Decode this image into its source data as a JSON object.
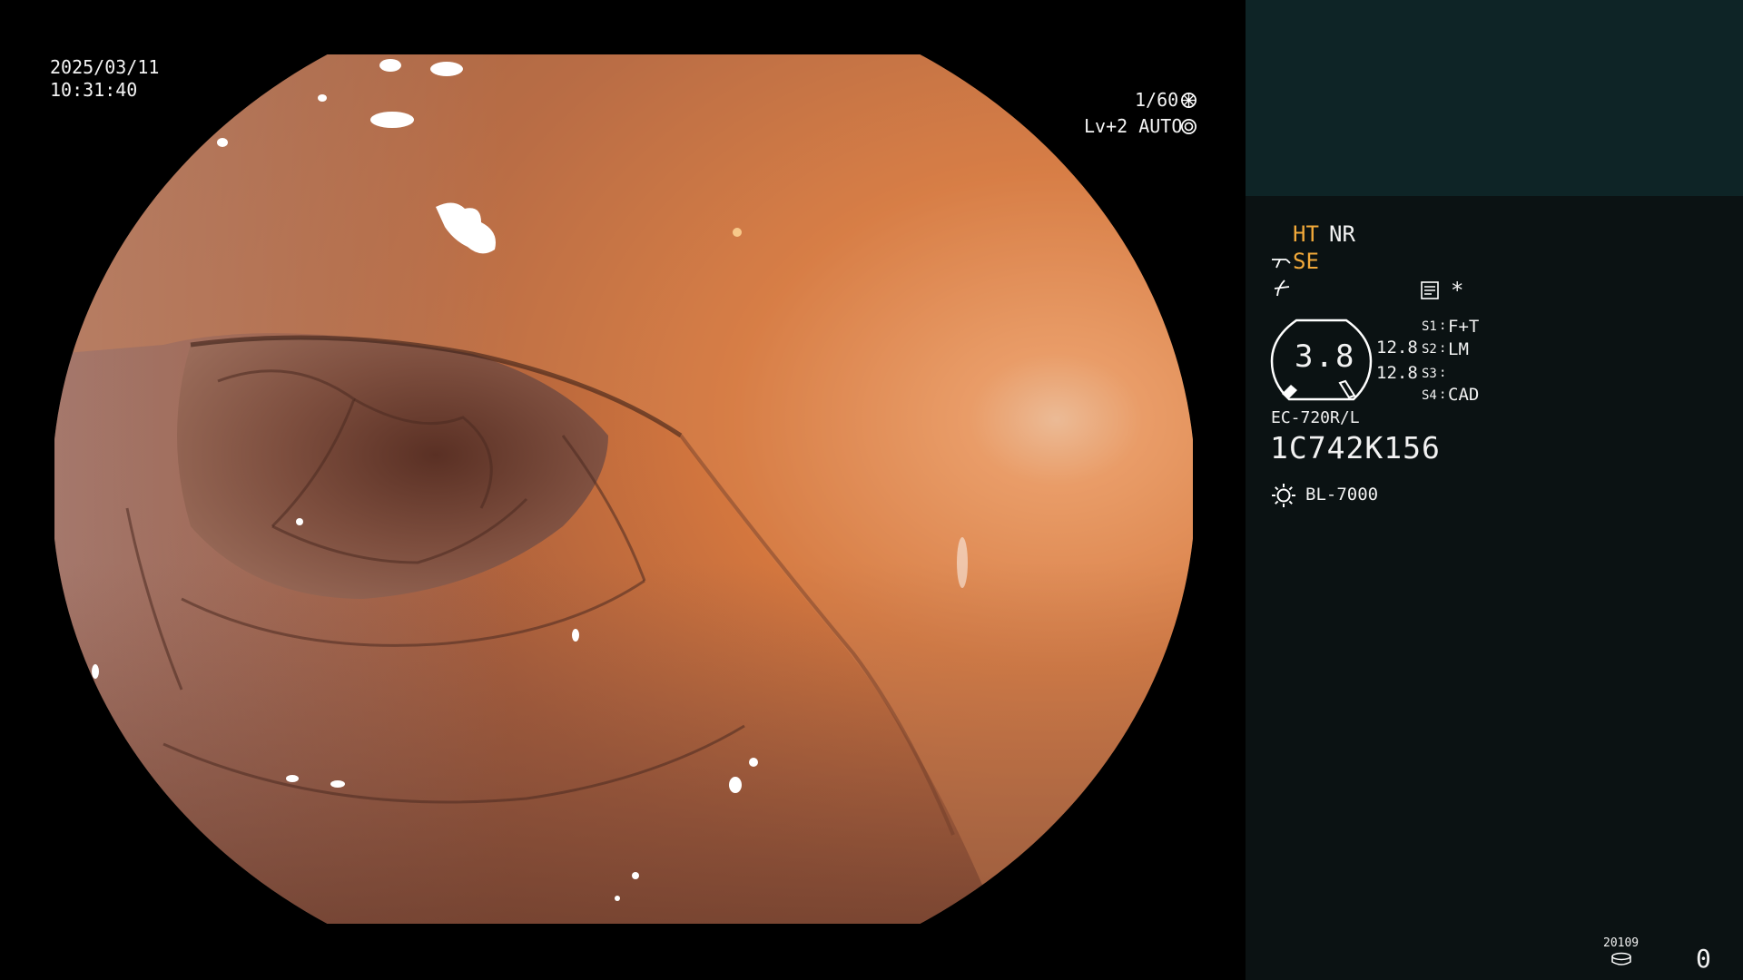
{
  "overlay": {
    "date": "2025/03/11",
    "time": "10:31:40",
    "shutter": "1/60",
    "level_mode": "Lv+2 AUTO"
  },
  "panel": {
    "ht": "HT",
    "nr": "NR",
    "se": "SE",
    "asterisk": "*",
    "zoom_value": "3.8",
    "val_a": "12.8",
    "val_b": "12.8",
    "switches": [
      {
        "key": "S1",
        "value": "F+T"
      },
      {
        "key": "S2",
        "value": "LM"
      },
      {
        "key": "S3",
        "value": ""
      },
      {
        "key": "S4",
        "value": "CAD"
      }
    ],
    "scope_model": "EC-720R/L",
    "scope_serial": "1C742K156",
    "light_source": "BL-7000",
    "counter_small": "20109",
    "counter_big": "0"
  },
  "icons": {
    "shutter": "aperture-icon",
    "auto": "iris-icon",
    "se": "scope-tip-icon",
    "curve": "tone-curve-icon",
    "memo": "memo-icon",
    "light": "lamp-icon",
    "storage": "storage-disk-icon"
  },
  "colors": {
    "panel_bg": "#0b1213",
    "panel_top_bg": "#0e2426",
    "orange_label": "#f2a93a"
  }
}
